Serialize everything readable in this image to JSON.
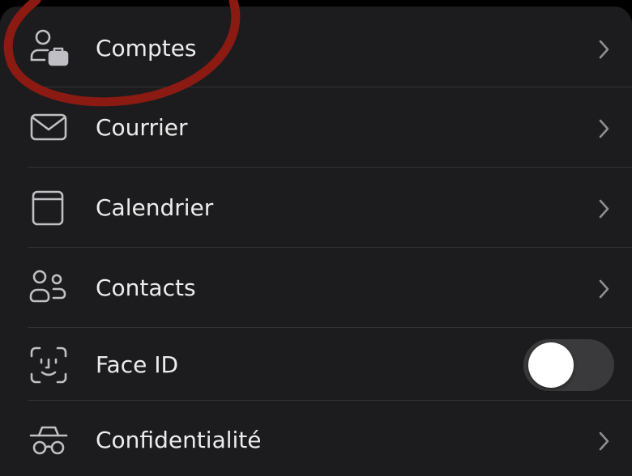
{
  "menu": {
    "items": [
      {
        "label": "Comptes",
        "icon": "account-briefcase-icon",
        "control": "chevron"
      },
      {
        "label": "Courrier",
        "icon": "mail-icon",
        "control": "chevron"
      },
      {
        "label": "Calendrier",
        "icon": "calendar-icon",
        "control": "chevron"
      },
      {
        "label": "Contacts",
        "icon": "contacts-icon",
        "control": "chevron"
      },
      {
        "label": "Face ID",
        "icon": "face-id-icon",
        "control": "toggle",
        "toggle_on": false
      },
      {
        "label": "Confidentialité",
        "icon": "privacy-incognito-icon",
        "control": "chevron"
      }
    ]
  },
  "colors": {
    "background": "#1c1c1e",
    "text": "#ececec",
    "icon": "#bfbfc4",
    "chevron": "#8e8e93",
    "toggle_track_off": "#3a3a3c",
    "annotation_circle": "#8b1a12"
  }
}
